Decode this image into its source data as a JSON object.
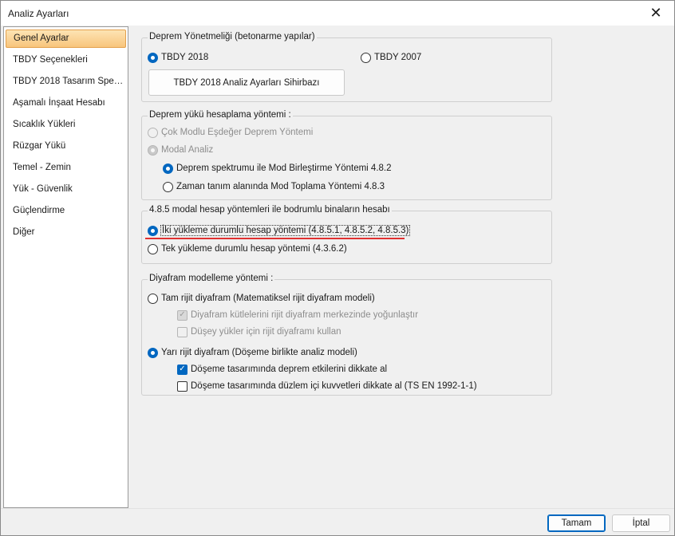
{
  "window": {
    "title": "Analiz Ayarları",
    "close_label": "✕"
  },
  "sidebar": {
    "items": [
      {
        "label": "Genel Ayarlar",
        "active": true
      },
      {
        "label": "TBDY Seçenekleri"
      },
      {
        "label": "TBDY 2018 Tasarım Spekt…"
      },
      {
        "label": "Aşamalı İnşaat Hesabı"
      },
      {
        "label": "Sıcaklık Yükleri"
      },
      {
        "label": "Rüzgar Yükü"
      },
      {
        "label": "Temel - Zemin"
      },
      {
        "label": "Yük - Güvenlik"
      },
      {
        "label": "Güçlendirme"
      },
      {
        "label": "Diğer"
      }
    ]
  },
  "regulation": {
    "title": "Deprem Yönetmeliği (betonarme yapılar)",
    "option_2018": "TBDY 2018",
    "option_2007": "TBDY 2007",
    "selected": "TBDY 2018",
    "wizard_button": "TBDY 2018 Analiz Ayarları Sihirbazı"
  },
  "load_method": {
    "title": "Deprem yükü hesaplama yöntemi :",
    "option_equivalent": "Çok Modlu Eşdeğer Deprem Yöntemi",
    "option_modal": "Modal Analiz",
    "option_spectrum": "Deprem spektrumu ile Mod Birleştirme Yöntemi 4.8.2",
    "option_time": "Zaman tanım alanında Mod Toplama Yöntemi 4.8.3",
    "selected": "Deprem spektrumu ile Mod Birleştirme Yöntemi 4.8.2"
  },
  "basement": {
    "title": "4.8.5 modal hesap yöntemleri ile bodrumlu binaların hesabı",
    "option_two": "İki yükleme durumlu hesap yöntemi (4.8.5.1, 4.8.5.2, 4.8.5.3)",
    "option_single": "Tek yükleme durumlu hesap yöntemi (4.3.6.2)",
    "selected": "İki yükleme durumlu hesap yöntemi (4.8.5.1, 4.8.5.2, 4.8.5.3)"
  },
  "diaphragm": {
    "title": "Diyafram modelleme yöntemi  :",
    "option_rigid": "Tam rijit diyafram (Matematiksel rijit diyafram modeli)",
    "check_mass": "Diyafram kütlelerini rijit diyafram merkezinde yoğunlaştır",
    "check_vertical": "Düşey yükler için rijit diyaframı kullan",
    "option_semi": "Yarı rijit diyafram (Döşeme birlikte analiz modeli)",
    "check_earthquake": "Döşeme tasarımında deprem etkilerini dikkate al",
    "check_inplane": "Döşeme tasarımında düzlem içi kuvvetleri dikkate al (TS EN 1992-1-1)",
    "selected": "Yarı rijit diyafram (Döşeme birlikte analiz modeli)",
    "check_mass_checked": true,
    "check_vertical_checked": false,
    "check_earthquake_checked": true,
    "check_inplane_checked": false
  },
  "footer": {
    "ok": "Tamam",
    "cancel": "İptal"
  },
  "colors": {
    "accent": "#0067c0",
    "active_item": "#f8c57c",
    "underline": "#e03030"
  }
}
